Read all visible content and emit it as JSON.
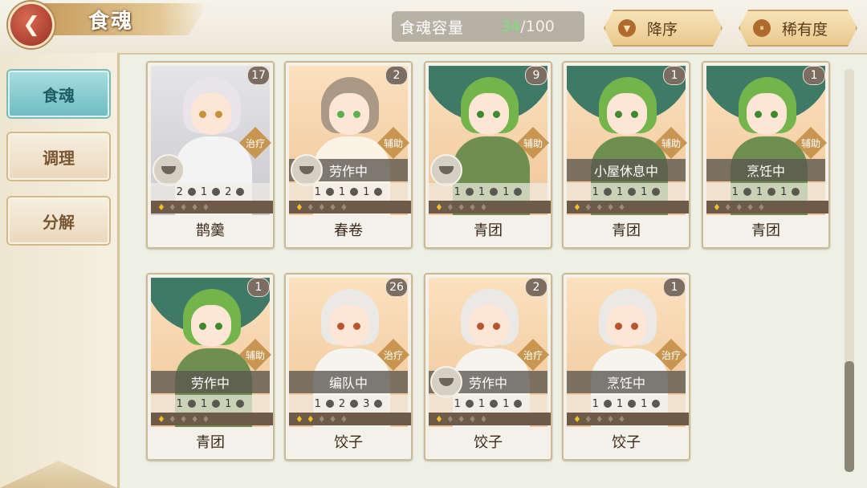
{
  "header": {
    "back_icon": "back-arrow-icon",
    "title": "食魂",
    "capacity_label": "食魂容量",
    "capacity_current": "34",
    "capacity_max": "/100",
    "sort_label": "降序",
    "rarity_label": "稀有度"
  },
  "sidebar": {
    "tabs": [
      {
        "label": "食魂",
        "active": true
      },
      {
        "label": "调理",
        "active": false
      },
      {
        "label": "分解",
        "active": false
      }
    ]
  },
  "cards": [
    {
      "name": "鹊羹",
      "level": "17",
      "role": "治疗",
      "status": "",
      "stats": [
        "2",
        "1",
        "2"
      ],
      "flames": 1,
      "theme": "silver"
    },
    {
      "name": "春卷",
      "level": "2",
      "role": "辅助",
      "status": "劳作中",
      "stats": [
        "1",
        "1",
        "1"
      ],
      "flames": 1,
      "theme": "peach"
    },
    {
      "name": "青团",
      "level": "9",
      "role": "辅助",
      "status": "",
      "stats": [
        "1",
        "1",
        "1"
      ],
      "flames": 1,
      "theme": "green"
    },
    {
      "name": "青团",
      "level": "1",
      "role": "辅助",
      "status": "小屋休息中",
      "stats": [
        "1",
        "1",
        "1"
      ],
      "flames": 1,
      "theme": "green"
    },
    {
      "name": "青团",
      "level": "1",
      "role": "辅助",
      "status": "烹饪中",
      "stats": [
        "1",
        "1",
        "1"
      ],
      "flames": 1,
      "theme": "green"
    },
    {
      "name": "青团",
      "level": "1",
      "role": "辅助",
      "status": "劳作中",
      "stats": [
        "1",
        "1",
        "1"
      ],
      "flames": 1,
      "theme": "green"
    },
    {
      "name": "饺子",
      "level": "26",
      "role": "治疗",
      "status": "编队中",
      "stats": [
        "1",
        "2",
        "3"
      ],
      "flames": 2,
      "theme": "white"
    },
    {
      "name": "饺子",
      "level": "2",
      "role": "治疗",
      "status": "劳作中",
      "stats": [
        "1",
        "1",
        "1"
      ],
      "flames": 1,
      "theme": "white"
    },
    {
      "name": "饺子",
      "level": "1",
      "role": "治疗",
      "status": "烹饪中",
      "stats": [
        "1",
        "1",
        "1"
      ],
      "flames": 1,
      "theme": "white"
    }
  ]
}
